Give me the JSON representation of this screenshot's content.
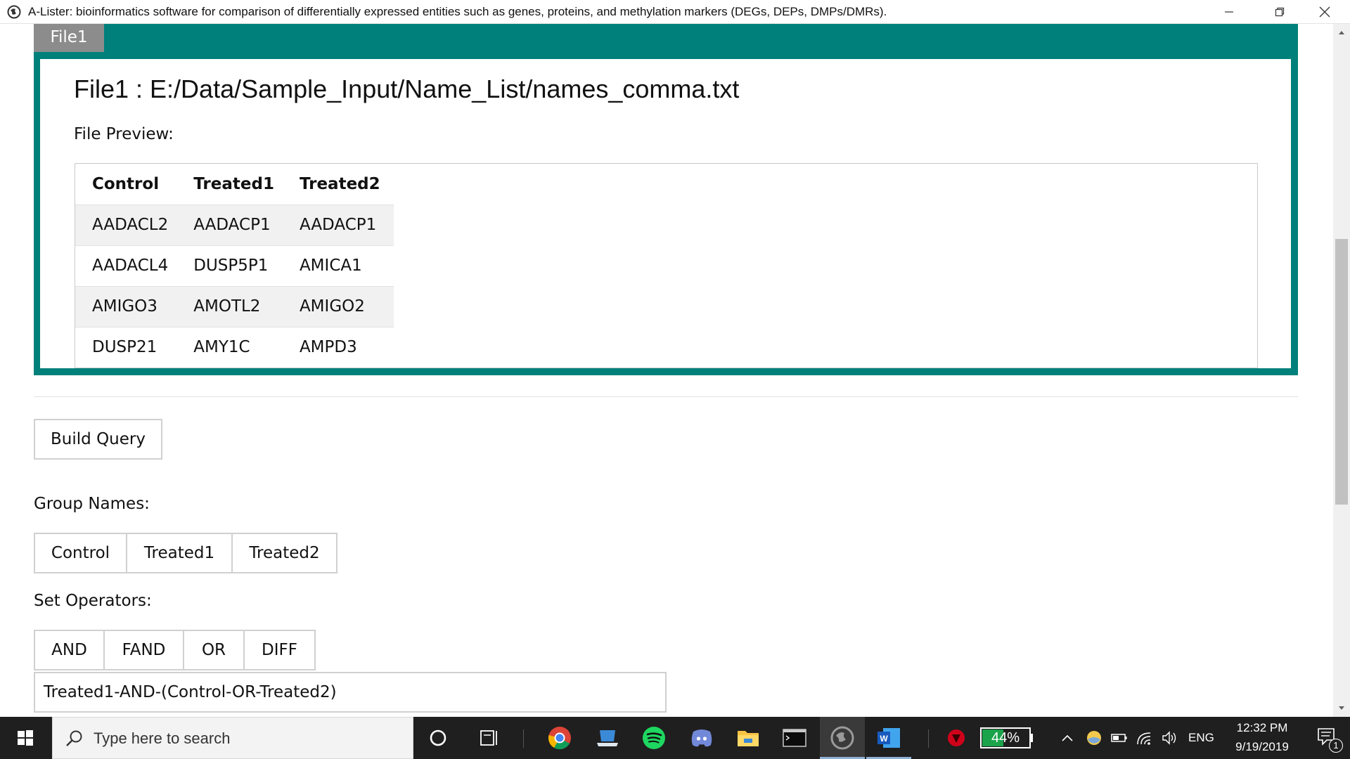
{
  "window": {
    "title": "A-Lister: bioinformatics software for comparison of differentially expressed entities such as genes, proteins, and methylation markers (DEGs, DEPs, DMPs/DMRs).",
    "icons": [
      "app-globe-icon",
      "minimize-icon",
      "restore-icon",
      "close-icon"
    ]
  },
  "file_panel": {
    "tab_label": "File1",
    "heading": "File1 : E:/Data/Sample_Input/Name_List/names_comma.txt",
    "preview_label": "File Preview:",
    "columns": [
      "Control",
      "Treated1",
      "Treated2"
    ],
    "rows": [
      [
        "AADACL2",
        "AADACP1",
        "AADACP1"
      ],
      [
        "AADACL4",
        "DUSP5P1",
        "AMICA1"
      ],
      [
        "AMIGO3",
        "AMOTL2",
        "AMIGO2"
      ],
      [
        "DUSP21",
        "AMY1C",
        "AMPD3"
      ]
    ],
    "colors": {
      "frame": "#00807a",
      "tab": "#8c8c8c"
    }
  },
  "query": {
    "build_button": "Build Query",
    "group_names_label": "Group Names:",
    "groups": [
      "Control",
      "Treated1",
      "Treated2"
    ],
    "set_operators_label": "Set Operators:",
    "operators": [
      "AND",
      "FAND",
      "OR",
      "DIFF"
    ],
    "expression": "Treated1-AND-(Control-OR-Treated2)"
  },
  "taskbar": {
    "search_placeholder": "Type here to search",
    "battery_percent": "44%",
    "language": "ENG",
    "time": "12:32 PM",
    "date": "9/19/2019",
    "notification_count": "1",
    "icons": [
      "windows-start-icon",
      "search-icon",
      "cortana-icon",
      "task-view-icon",
      "chrome-icon",
      "laptop-app-icon",
      "spotify-icon",
      "discord-icon",
      "file-explorer-icon",
      "terminal-icon",
      "a-lister-app-icon",
      "word-icon",
      "antivirus-icon",
      "battery-meter-icon",
      "show-hidden-icons-chevron",
      "weather-icon",
      "battery-icon",
      "wifi-icon",
      "volume-icon",
      "notifications-icon"
    ]
  }
}
